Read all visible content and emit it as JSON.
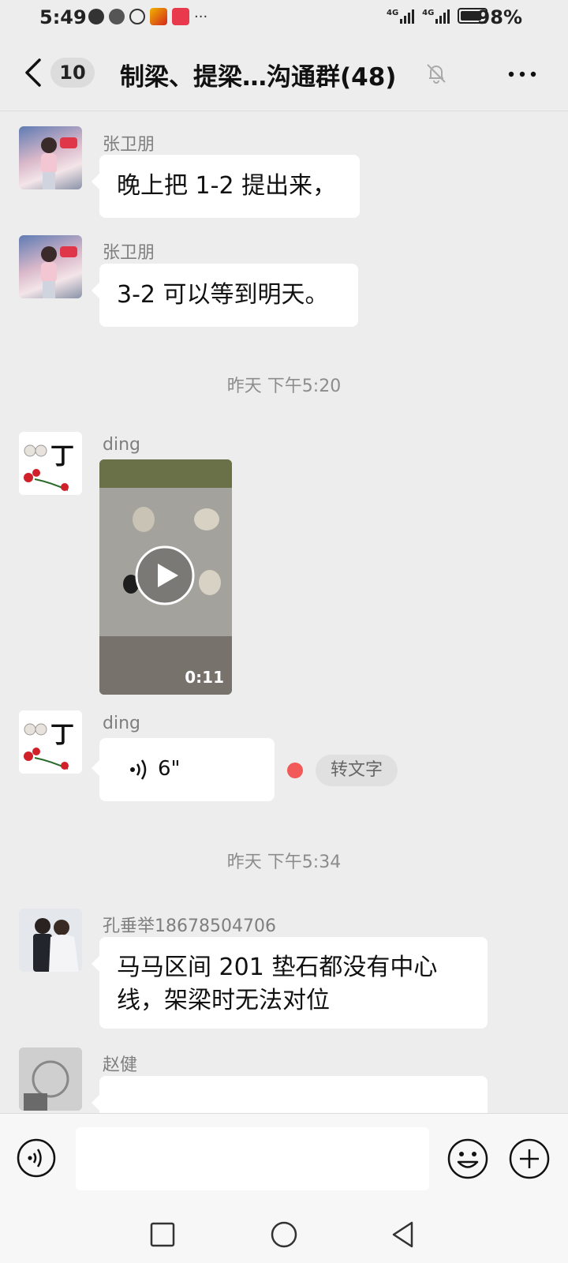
{
  "status_bar": {
    "time": "5:49",
    "network_1": "4G",
    "network_2": "4G",
    "battery_percent": "98%",
    "battery_level": 0.98
  },
  "header": {
    "unread_count": "10",
    "title": "制梁、提梁…沟通群(48)"
  },
  "messages": [
    {
      "sender": "张卫朋",
      "type": "text",
      "text": "晚上把 1-2 提出来，"
    },
    {
      "sender": "张卫朋",
      "type": "text",
      "text": "3-2 可以等到明天。"
    },
    {
      "type": "timestamp",
      "text": "昨天 下午5:20"
    },
    {
      "sender": "ding",
      "type": "video",
      "duration": "0:11"
    },
    {
      "sender": "ding",
      "type": "voice",
      "duration": "6\"",
      "to_text_label": "转文字"
    },
    {
      "type": "timestamp",
      "text": "昨天 下午5:34"
    },
    {
      "sender": "孔垂举18678504706",
      "type": "text",
      "text_line1": "马马区间 201 垫石都没有中心",
      "text_line2": "线，架梁时无法对位"
    },
    {
      "sender": "赵健",
      "type": "text",
      "text": ""
    }
  ],
  "avatars": {
    "ding_char": "丁"
  },
  "input": {
    "value": "",
    "placeholder": ""
  },
  "colors": {
    "background": "#ededed",
    "bubble": "#ffffff",
    "unread_dot": "#f25a5a",
    "sender_name": "#7f7f7f"
  },
  "icons": [
    "back-icon",
    "mute-bell-icon",
    "more-icon",
    "play-icon",
    "voice-wave-icon",
    "emoji-icon",
    "plus-icon",
    "square-nav-icon",
    "circle-nav-icon",
    "triangle-back-nav-icon"
  ]
}
